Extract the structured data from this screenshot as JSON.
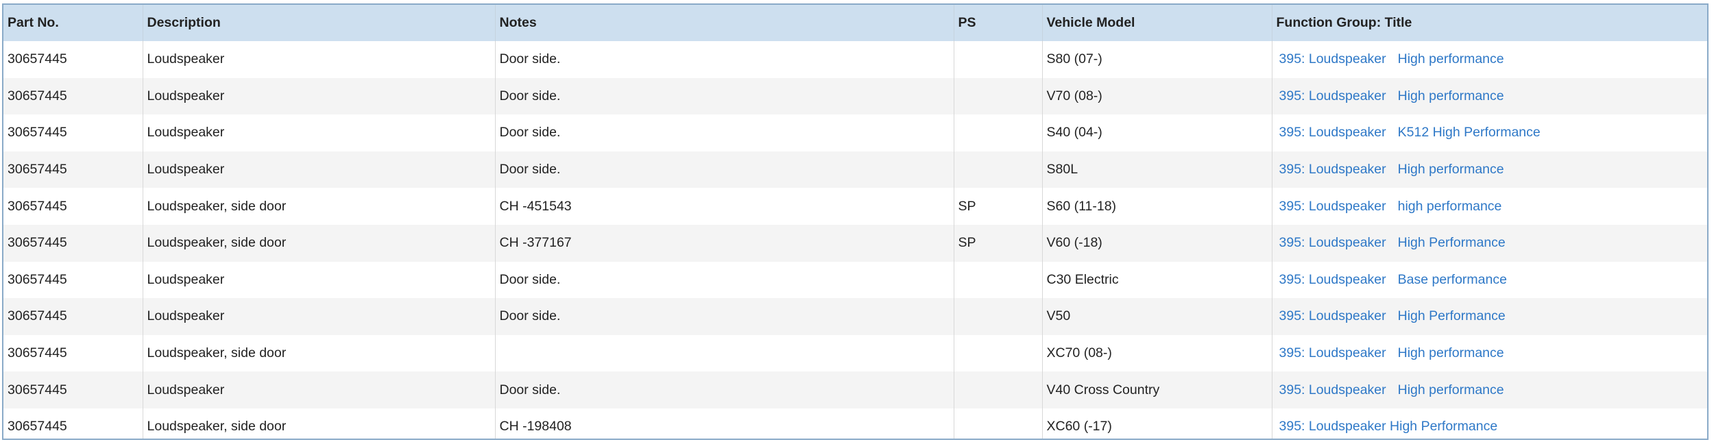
{
  "table": {
    "headers": {
      "part_no": "Part No.",
      "description": "Description",
      "notes": "Notes",
      "ps": "PS",
      "vehicle_model": "Vehicle Model",
      "function_group": "Function Group: Title"
    },
    "rows": [
      {
        "part_no": "30657445",
        "description": "Loudspeaker",
        "notes": "Door side.",
        "ps": "",
        "vehicle_model": "S80 (07-)",
        "group_link": "395: Loudspeaker",
        "title_link": "High performance"
      },
      {
        "part_no": "30657445",
        "description": "Loudspeaker",
        "notes": "Door side.",
        "ps": "",
        "vehicle_model": "V70 (08-)",
        "group_link": "395: Loudspeaker",
        "title_link": "High performance"
      },
      {
        "part_no": "30657445",
        "description": "Loudspeaker",
        "notes": "Door side.",
        "ps": "",
        "vehicle_model": "S40 (04-)",
        "group_link": "395: Loudspeaker",
        "title_link": "K512 High Performance"
      },
      {
        "part_no": "30657445",
        "description": "Loudspeaker",
        "notes": "Door side.",
        "ps": "",
        "vehicle_model": "S80L",
        "group_link": "395: Loudspeaker",
        "title_link": "High performance"
      },
      {
        "part_no": "30657445",
        "description": "Loudspeaker, side door",
        "notes": "CH -451543",
        "ps": "SP",
        "vehicle_model": "S60 (11-18)",
        "group_link": "395: Loudspeaker",
        "title_link": "high performance"
      },
      {
        "part_no": "30657445",
        "description": "Loudspeaker, side door",
        "notes": "CH -377167",
        "ps": "SP",
        "vehicle_model": "V60 (-18)",
        "group_link": "395: Loudspeaker",
        "title_link": "High Performance"
      },
      {
        "part_no": "30657445",
        "description": "Loudspeaker",
        "notes": "Door side.",
        "ps": "",
        "vehicle_model": "C30 Electric",
        "group_link": "395: Loudspeaker",
        "title_link": "Base performance"
      },
      {
        "part_no": "30657445",
        "description": "Loudspeaker",
        "notes": "Door side.",
        "ps": "",
        "vehicle_model": "V50",
        "group_link": "395: Loudspeaker",
        "title_link": "High Performance"
      },
      {
        "part_no": "30657445",
        "description": "Loudspeaker, side door",
        "notes": "",
        "ps": "",
        "vehicle_model": "XC70 (08-)",
        "group_link": "395: Loudspeaker",
        "title_link": "High performance"
      },
      {
        "part_no": "30657445",
        "description": "Loudspeaker",
        "notes": "Door side.",
        "ps": "",
        "vehicle_model": "V40 Cross Country",
        "group_link": "395: Loudspeaker",
        "title_link": "High performance"
      },
      {
        "part_no": "30657445",
        "description": "Loudspeaker, side door",
        "notes": "CH -198408",
        "ps": "",
        "vehicle_model": "XC60 (-17)",
        "group_link": "395: Loudspeaker High Performance",
        "title_link": ""
      }
    ]
  },
  "colors": {
    "header_bg": "#cddfef",
    "row_alt_bg": "#f4f4f4",
    "link": "#2e78c7",
    "border": "#8aaac8"
  }
}
